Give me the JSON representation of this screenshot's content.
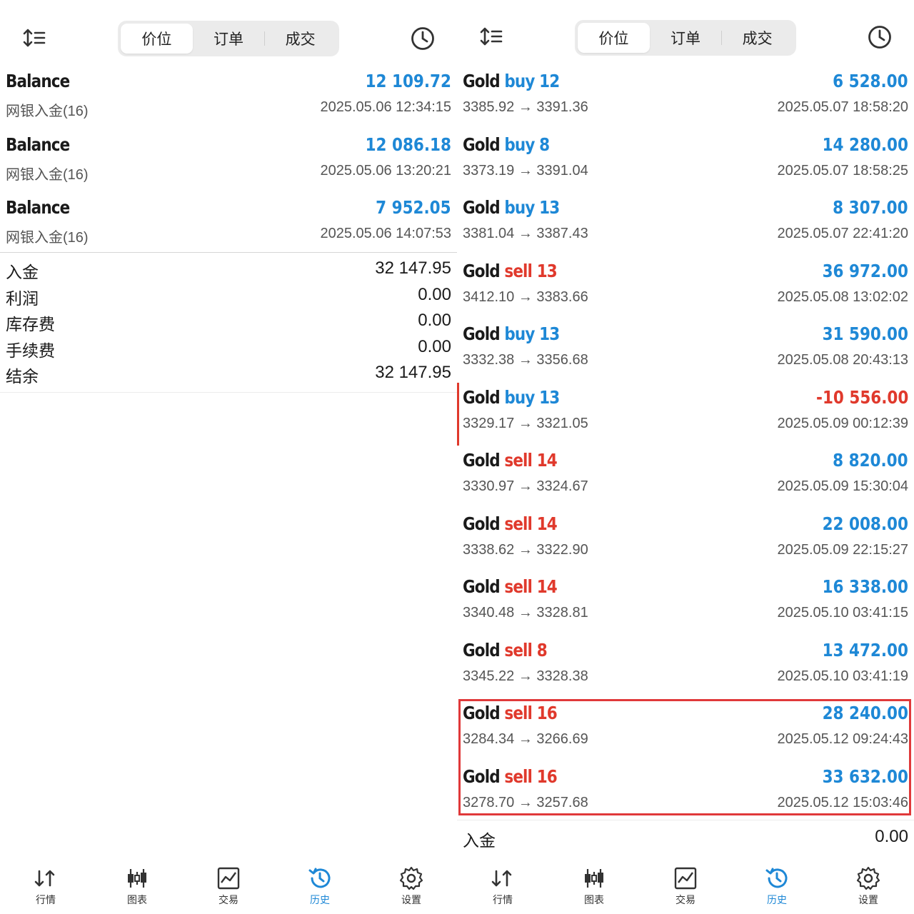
{
  "left": {
    "tabs": [
      "价位",
      "订单",
      "成交"
    ],
    "rows": [
      {
        "title": "Balance",
        "subtitle": "网银入金(16)",
        "amount": "12 109.72",
        "date": "2025.05.06 12:34:15"
      },
      {
        "title": "Balance",
        "subtitle": "网银入金(16)",
        "amount": "12 086.18",
        "date": "2025.05.06 13:20:21"
      },
      {
        "title": "Balance",
        "subtitle": "网银入金(16)",
        "amount": "7 952.05",
        "date": "2025.05.06 14:07:53"
      }
    ],
    "summary": [
      {
        "label": "入金",
        "value": "32 147.95"
      },
      {
        "label": "利润",
        "value": "0.00"
      },
      {
        "label": "库存费",
        "value": "0.00"
      },
      {
        "label": "手续费",
        "value": "0.00"
      },
      {
        "label": "结余",
        "value": "32 147.95"
      }
    ]
  },
  "right": {
    "tabs": [
      "价位",
      "订单",
      "成交"
    ],
    "trades": [
      {
        "symbol": "Gold",
        "side": "buy",
        "volume": "12",
        "prices": "3385.92 → 3391.36",
        "profit": "6 528.00",
        "date": "2025.05.07 18:58:20"
      },
      {
        "symbol": "Gold",
        "side": "buy",
        "volume": "8",
        "prices": "3373.19 → 3391.04",
        "profit": "14 280.00",
        "date": "2025.05.07 18:58:25"
      },
      {
        "symbol": "Gold",
        "side": "buy",
        "volume": "13",
        "prices": "3381.04 → 3387.43",
        "profit": "8 307.00",
        "date": "2025.05.07 22:41:20"
      },
      {
        "symbol": "Gold",
        "side": "sell",
        "volume": "13",
        "prices": "3412.10 → 3383.66",
        "profit": "36 972.00",
        "date": "2025.05.08 13:02:02"
      },
      {
        "symbol": "Gold",
        "side": "buy",
        "volume": "13",
        "prices": "3332.38 → 3356.68",
        "profit": "31 590.00",
        "date": "2025.05.08 20:43:13"
      },
      {
        "symbol": "Gold",
        "side": "buy",
        "volume": "13",
        "prices": "3329.17 → 3321.05",
        "profit": "-10 556.00",
        "date": "2025.05.09 00:12:39"
      },
      {
        "symbol": "Gold",
        "side": "sell",
        "volume": "14",
        "prices": "3330.97 → 3324.67",
        "profit": "8 820.00",
        "date": "2025.05.09 15:30:04"
      },
      {
        "symbol": "Gold",
        "side": "sell",
        "volume": "14",
        "prices": "3338.62 → 3322.90",
        "profit": "22 008.00",
        "date": "2025.05.09 22:15:27"
      },
      {
        "symbol": "Gold",
        "side": "sell",
        "volume": "14",
        "prices": "3340.48 → 3328.81",
        "profit": "16 338.00",
        "date": "2025.05.10 03:41:15"
      },
      {
        "symbol": "Gold",
        "side": "sell",
        "volume": "8",
        "prices": "3345.22 → 3328.38",
        "profit": "13 472.00",
        "date": "2025.05.10 03:41:19"
      },
      {
        "symbol": "Gold",
        "side": "sell",
        "volume": "16",
        "prices": "3284.34 → 3266.69",
        "profit": "28 240.00",
        "date": "2025.05.12 09:24:43"
      },
      {
        "symbol": "Gold",
        "side": "sell",
        "volume": "16",
        "prices": "3278.70 → 3257.68",
        "profit": "33 632.00",
        "date": "2025.05.12 15:03:46"
      }
    ],
    "summary_partial": {
      "label": "入金",
      "value": "0.00"
    }
  },
  "nav": [
    "行情",
    "图表",
    "交易",
    "历史",
    "设置"
  ],
  "colors": {
    "accent": "#1e88d6",
    "loss": "#e0392c",
    "highlight": "#e0393a"
  }
}
